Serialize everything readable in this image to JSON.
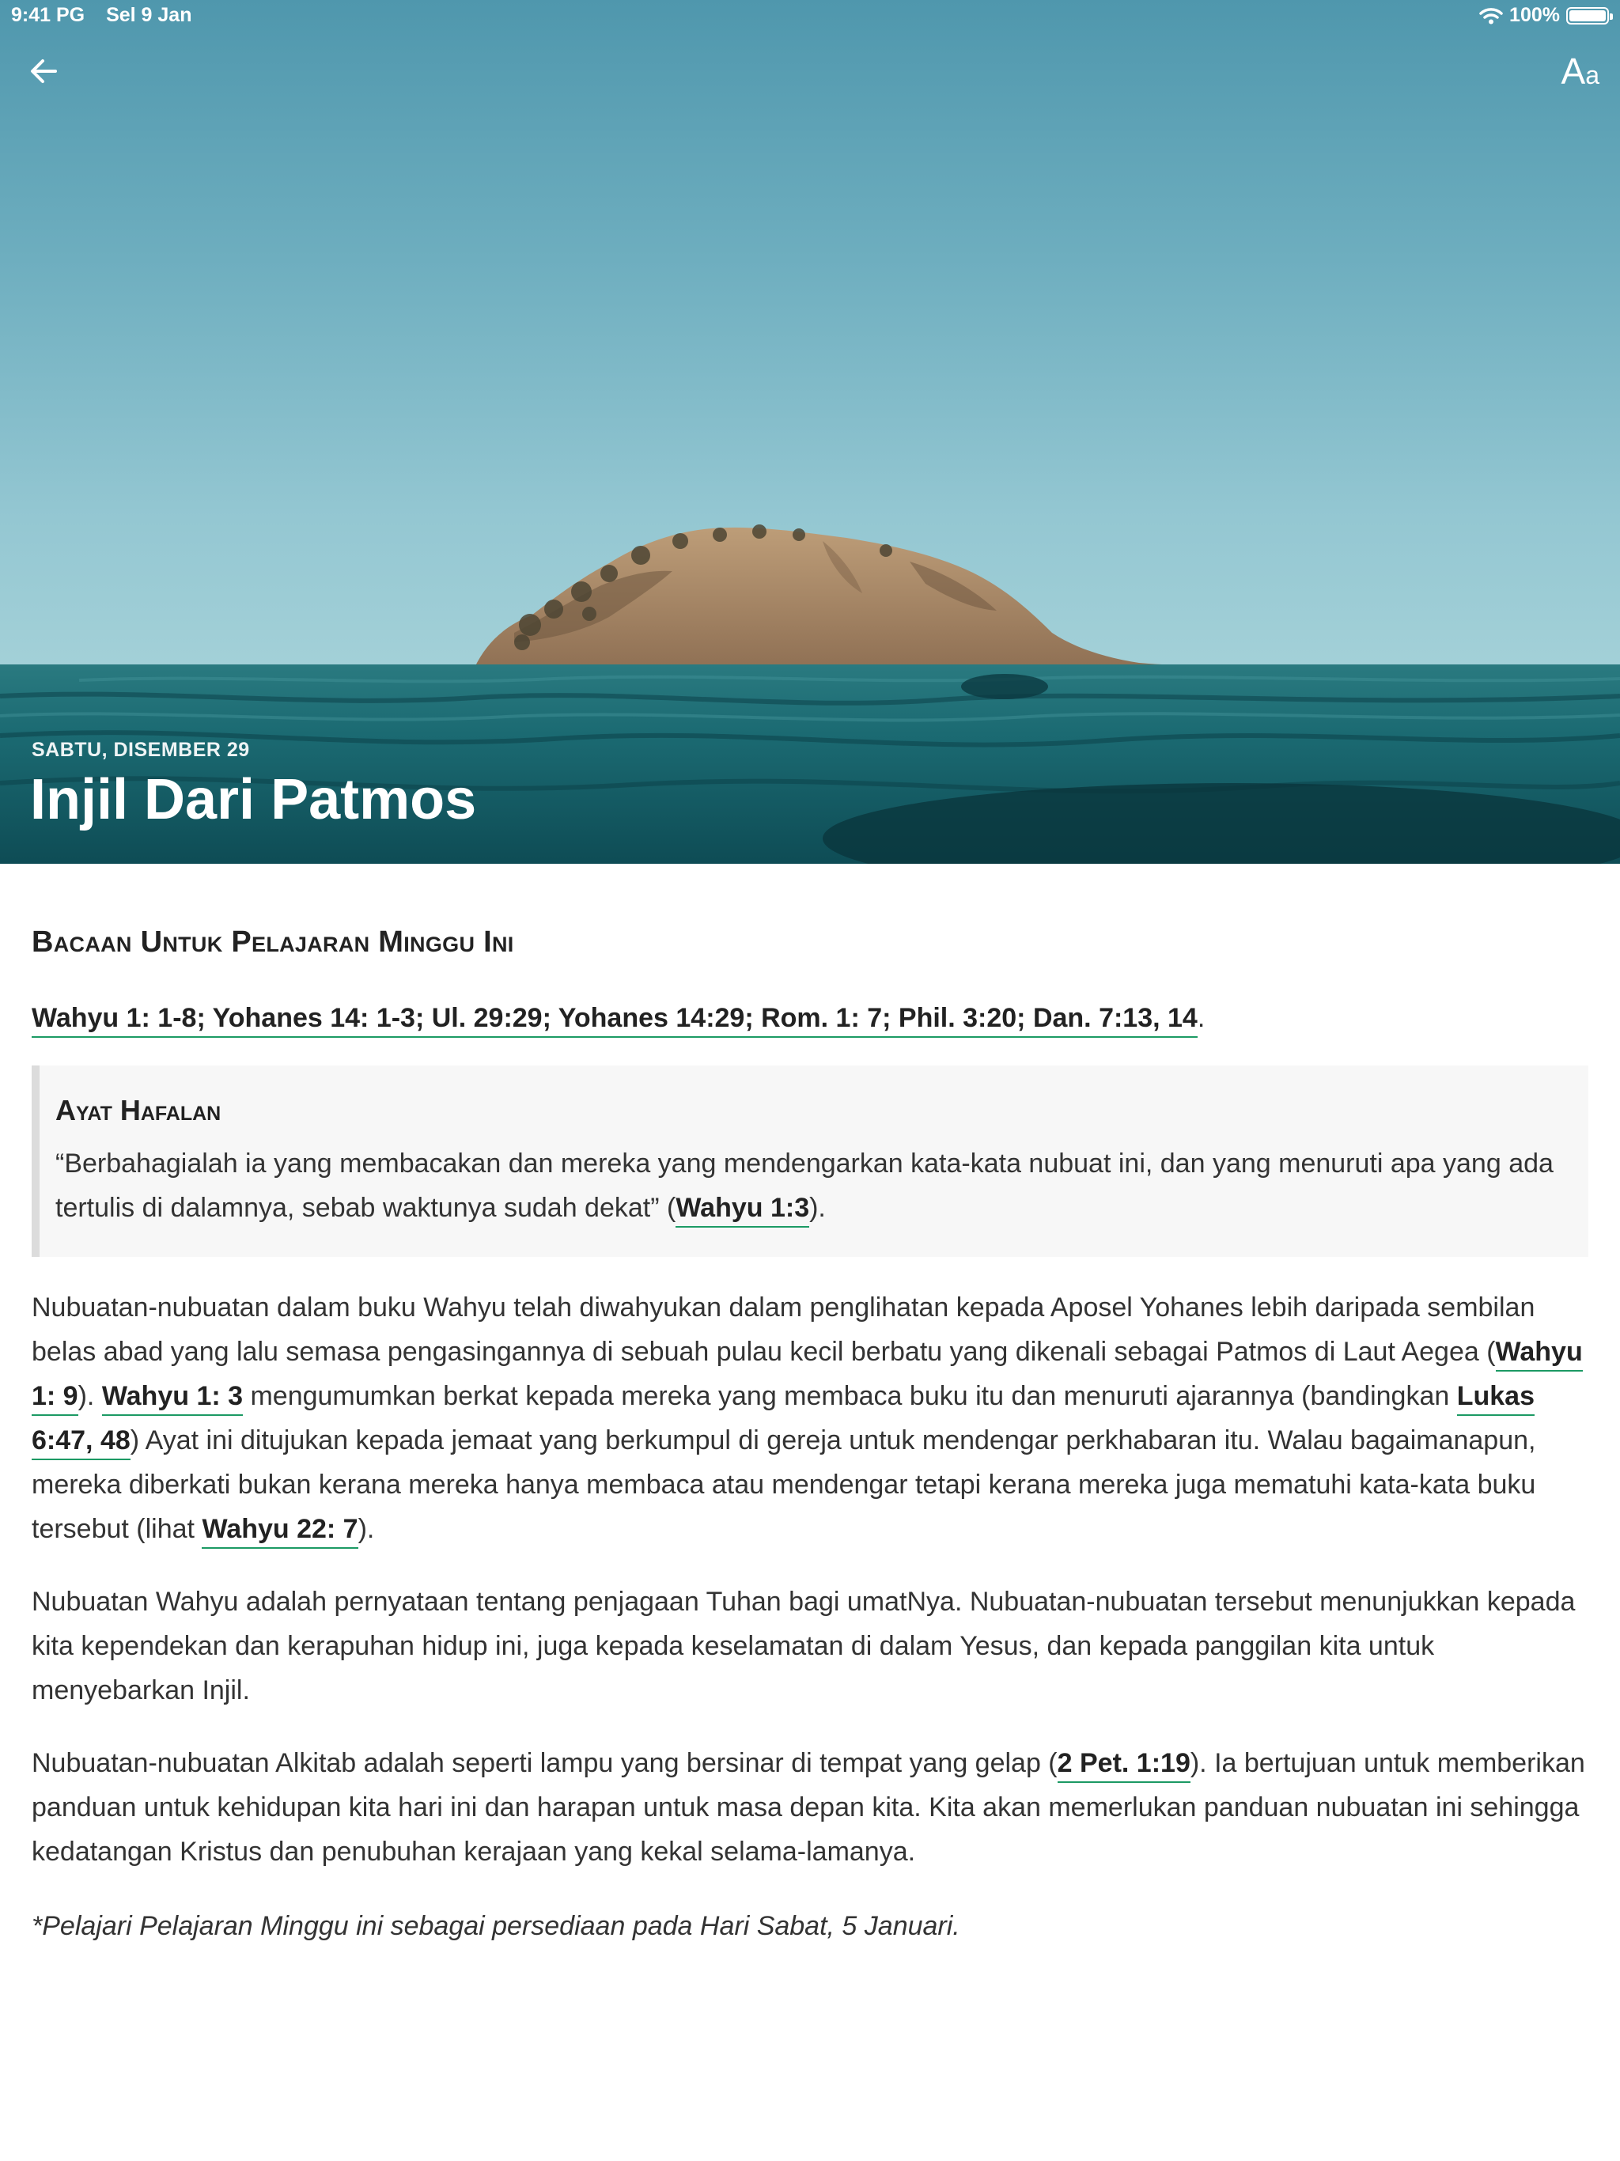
{
  "status_bar": {
    "time": "9:41 PG",
    "date": "Sel 9 Jan",
    "battery": "100%",
    "battery_level": 1.0
  },
  "header": {
    "back_icon": "arrow-left-icon",
    "font_button": {
      "big": "A",
      "small": "a"
    },
    "date": "SABTU, DISEMBER 29",
    "title": "Injil Dari Patmos",
    "colors": {
      "sky": "#6eaebf",
      "sea": "#16696f",
      "island": "#a88865"
    }
  },
  "content": {
    "section_heading": "Bacaan Untuk Pelajaran Minggu Ini",
    "readings": [
      "Wahyu 1: 1-8; Yohanes 14: 1-3; Ul. 29:29; Yohanes 14:29; Rom. 1: 7; Phil. 3:20; Dan. 7:13, 14",
      "."
    ],
    "memory": {
      "heading": "Ayat Hafalan",
      "text": "“Berbahagialah ia yang membacakan dan mereka yang mendengarkan kata-kata nubuat ini, dan yang menuruti apa yang ada tertulis di dalamnya, sebab waktunya sudah dekat” (",
      "ref": "Wahyu 1:3",
      "after": ")."
    },
    "p1": [
      "Nubuatan-nubuatan dalam buku Wahyu telah diwahyukan dalam penglihatan kepada Aposel Yohanes lebih daripada sembilan belas abad yang lalu semasa pengasingannya di sebuah pulau kecil berbatu yang dikenali sebagai Patmos di Laut Aegea (",
      "Wahyu 1: 9",
      "). ",
      "Wahyu 1: 3",
      " mengumumkan berkat kepada mereka yang membaca buku itu dan menuruti ajarannya (bandingkan ",
      "Lukas 6:47, 48",
      ") Ayat ini ditujukan kepada jemaat yang berkumpul di gereja untuk mendengar perkhabaran itu. Walau bagaimanapun, mereka diberkati bukan kerana mereka hanya membaca atau mendengar tetapi kerana mereka juga mematuhi kata-kata buku tersebut (lihat ",
      "Wahyu 22: 7",
      ")."
    ],
    "p2": "Nubuatan Wahyu adalah pernyataan tentang penjagaan Tuhan bagi umatNya. Nubuatan-nubuatan tersebut menunjukkan kepada kita kependekan dan kerapuhan hidup ini, juga kepada keselamatan di dalam Yesus, dan kepada panggilan kita untuk menyebarkan Injil.",
    "p3": [
      "Nubuatan-nubuatan Alkitab adalah seperti lampu yang bersinar di tempat yang gelap (",
      "2 Pet. 1:19",
      "). Ia bertujuan untuk memberikan panduan untuk kehidupan kita hari ini dan harapan untuk masa depan kita. Kita akan memerlukan panduan nubuatan ini sehingga kedatangan Kristus dan penubuhan kerajaan yang kekal selama-lamanya."
    ],
    "note": "*Pelajari Pelajaran Minggu ini sebagai persediaan pada Hari Sabat, 5 Januari."
  }
}
